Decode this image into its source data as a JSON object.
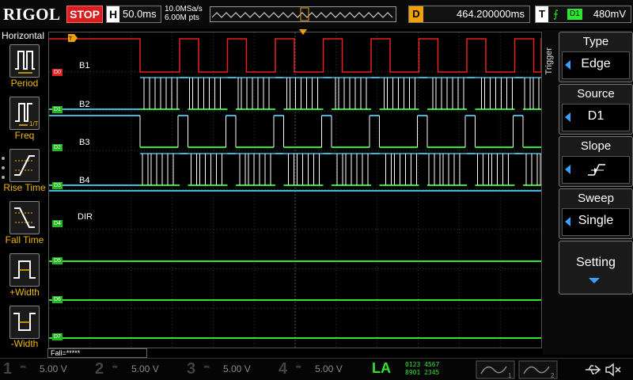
{
  "header": {
    "logo": "RIGOL",
    "run_state": "STOP",
    "timebase_key": "H",
    "timebase_value": "50.0ms",
    "sample_rate": "10.0MSa/s",
    "memory_points": "6.00M pts",
    "delay_key": "D",
    "delay_value": "464.200000ms",
    "trigger_key": "T",
    "trigger_edge": "⨍",
    "trigger_source": "D1",
    "trigger_level": "480mV"
  },
  "left_panel": {
    "title": "Horizontal",
    "buttons": [
      {
        "label": "Period",
        "icon": "period-icon"
      },
      {
        "label": "Freq",
        "icon": "frequency-icon"
      },
      {
        "label": "Rise Time",
        "icon": "rise-time-icon"
      },
      {
        "label": "Fall Time",
        "icon": "fall-time-icon"
      },
      {
        "label": "+Width",
        "icon": "positive-width-icon"
      },
      {
        "label": "-Width",
        "icon": "negative-width-icon"
      }
    ]
  },
  "channels": [
    {
      "tag": "D0",
      "label": "B1",
      "tag_color": "#e32222"
    },
    {
      "tag": "D1",
      "label": "B2",
      "tag_color": "#22b822"
    },
    {
      "tag": "D2",
      "label": "B3",
      "tag_color": "#22b822"
    },
    {
      "tag": "D3",
      "label": "B4",
      "tag_color": "#22b822"
    },
    {
      "tag": "D4",
      "label": "DIR",
      "tag_color": "#22b822"
    },
    {
      "tag": "D5",
      "label": "",
      "tag_color": "#22b822"
    },
    {
      "tag": "D6",
      "label": "",
      "tag_color": "#22b822"
    },
    {
      "tag": "D7",
      "label": "",
      "tag_color": "#22b822"
    }
  ],
  "trigger_menu": {
    "title": "Trigger",
    "items": [
      {
        "title": "Type",
        "value": "Edge"
      },
      {
        "title": "Source",
        "value": "D1"
      },
      {
        "title": "Slope",
        "value": "",
        "icon": "rising-edge-icon"
      },
      {
        "title": "Sweep",
        "value": "Single"
      }
    ],
    "setting_label": "Setting"
  },
  "measure_bar": "Fall=*****",
  "bottom": {
    "analog": [
      {
        "num": "1",
        "value": "5.00 V"
      },
      {
        "num": "2",
        "value": "5.00 V"
      },
      {
        "num": "3",
        "value": "5.00 V"
      },
      {
        "num": "4",
        "value": "5.00 V"
      }
    ],
    "la_label": "LA",
    "la_groups_top": "0123 4567",
    "la_groups_bottom": "8901 2345"
  },
  "colors": {
    "stop": "#d81e1e",
    "high": "#2ee62e",
    "low": "#3fb8d8",
    "trace_red": "#e82020",
    "accent": "#f0b800",
    "trigger_arrow": "#f0a000"
  }
}
